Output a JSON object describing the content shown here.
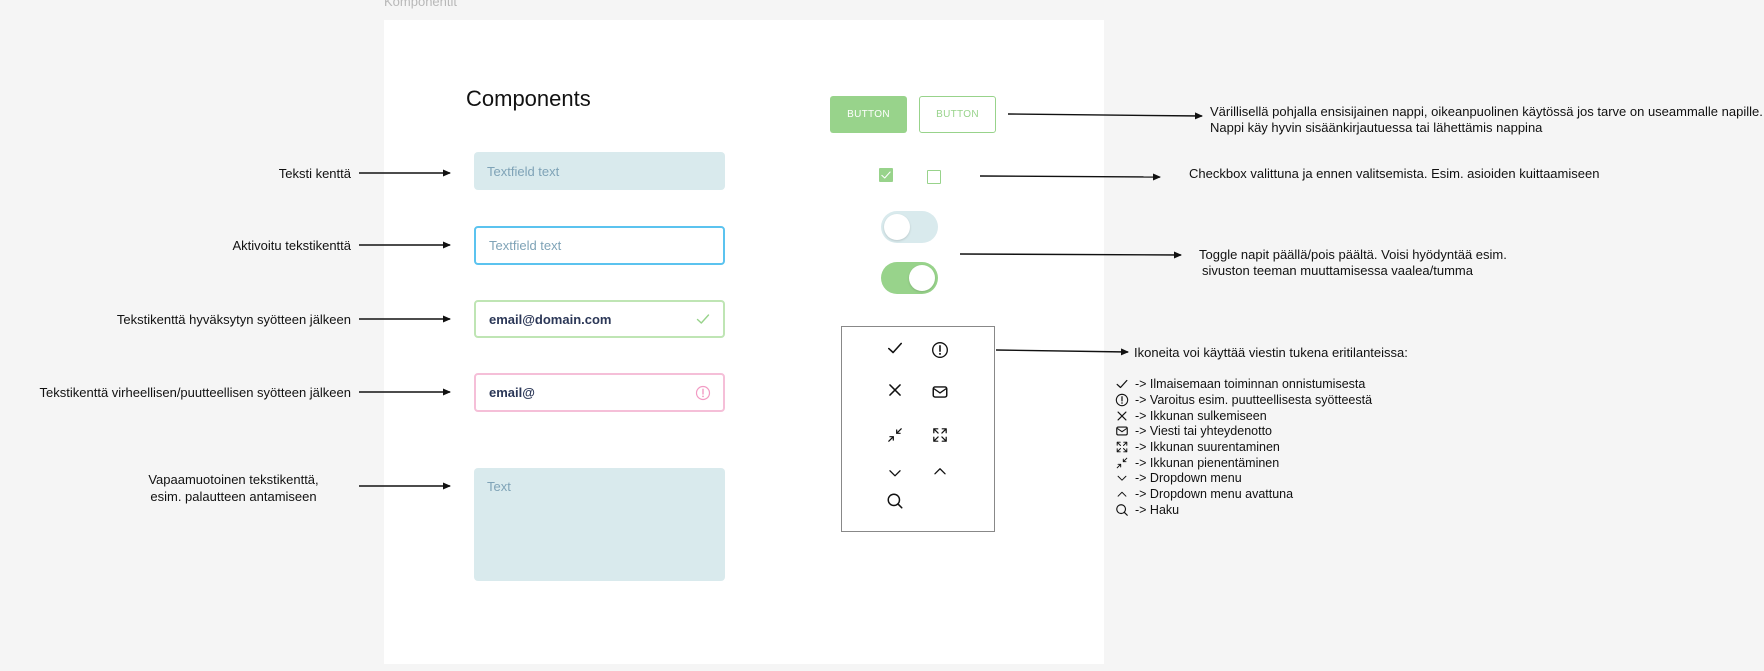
{
  "frame": {
    "title": "Komponentit",
    "heading": "Components"
  },
  "fields": {
    "text_placeholder": "Textfield text",
    "active_placeholder": "Textfield text",
    "valid_value": "email@domain.com",
    "error_value": "email@",
    "textarea_placeholder": "Text"
  },
  "labels": {
    "text_field": "Teksti kenttä",
    "active_field": "Aktivoitu tekstikenttä",
    "valid_field": "Tekstikenttä hyväksytyn syötteen jälkeen",
    "error_field": "Tekstikenttä virheellisen/puutteellisen syötteen jälkeen",
    "textarea_line1": "Vapaamuotoinen tekstikenttä,",
    "textarea_line2": "esim. palautteen antamiseen"
  },
  "buttons": {
    "primary_label": "BUTTON",
    "secondary_label": "BUTTON"
  },
  "checkboxes": {
    "first_checked": true,
    "second_checked": false
  },
  "toggles": {
    "first_on": false,
    "second_on": true
  },
  "descriptions": {
    "buttons_line1": "Värillisellä pohjalla ensisijainen nappi, oikeanpuolinen käytössä jos tarve on useammalle napille.",
    "buttons_line2": "Nappi käy hyvin sisäänkirjautuessa tai lähettämis nappina",
    "checkbox": "Checkbox valittuna ja ennen valitsemista. Esim. asioiden kuittaamiseen",
    "toggle_line1": "Toggle napit päällä/pois päältä. Voisi hyödyntää esim.",
    "toggle_line2": "sivuston teeman muuttamisessa vaalea/tumma",
    "icons_intro": "Ikoneita voi käyttää viestin tukena eritilanteissa:"
  },
  "icon_legend": [
    {
      "icon": "check-icon",
      "text": "-> Ilmaisemaan toiminnan onnistumisesta"
    },
    {
      "icon": "alert-icon",
      "text": "-> Varoitus esim. puutteellisesta syötteestä"
    },
    {
      "icon": "close-icon",
      "text": "-> Ikkunan sulkemiseen"
    },
    {
      "icon": "mail-icon",
      "text": "-> Viesti tai yhteydenotto"
    },
    {
      "icon": "expand-icon",
      "text": "-> Ikkunan suurentaminen"
    },
    {
      "icon": "collapse-icon",
      "text": "-> Ikkunan pienentäminen"
    },
    {
      "icon": "chevron-down-icon",
      "text": "-> Dropdown menu"
    },
    {
      "icon": "chevron-up-icon",
      "text": "-> Dropdown menu avattuna"
    },
    {
      "icon": "search-icon",
      "text": "-> Haku"
    }
  ],
  "colors": {
    "accent_green": "#98d38b",
    "field_fill": "#d9eaed",
    "active_border": "#5bc3ef",
    "valid_border": "#bfe5b4",
    "error_border": "#f5bfd8",
    "placeholder_text": "#7fa3b7",
    "value_text": "#2b3757"
  }
}
